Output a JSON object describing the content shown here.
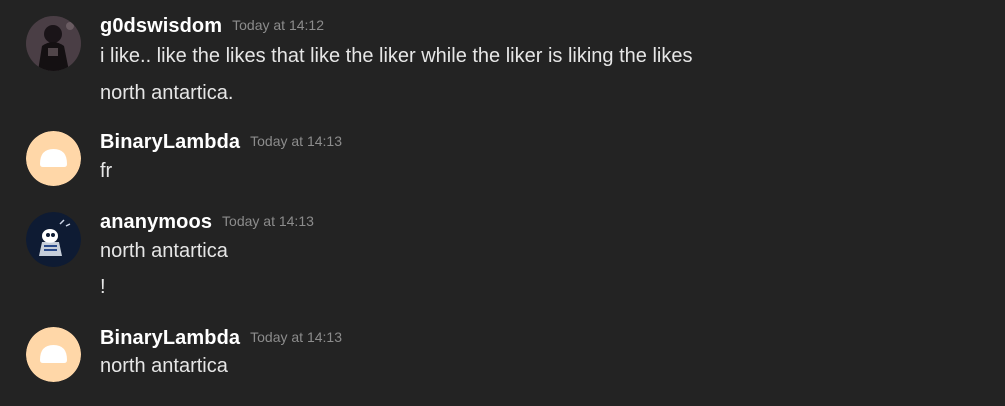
{
  "messages": [
    {
      "username": "g0dswisdom",
      "timestamp": "Today at 14:12",
      "avatar_icon": "dark-figure-avatar",
      "lines": [
        "i like.. like the likes that like the liker while the liker is liking the likes",
        "north antartica."
      ]
    },
    {
      "username": "BinaryLambda",
      "timestamp": "Today at 14:13",
      "avatar_icon": "peach-blob-avatar",
      "lines": [
        "fr"
      ]
    },
    {
      "username": "ananymoos",
      "timestamp": "Today at 14:13",
      "avatar_icon": "navy-character-avatar",
      "lines": [
        "north antartica",
        "!"
      ]
    },
    {
      "username": "BinaryLambda",
      "timestamp": "Today at 14:13",
      "avatar_icon": "peach-blob-avatar",
      "lines": [
        "north antartica"
      ]
    }
  ],
  "colors": {
    "background": "#232323",
    "username": "#ffffff",
    "timestamp": "#8c8c8c",
    "message_text": "#e6e6e6",
    "peach_avatar": "#ffd7a8"
  }
}
